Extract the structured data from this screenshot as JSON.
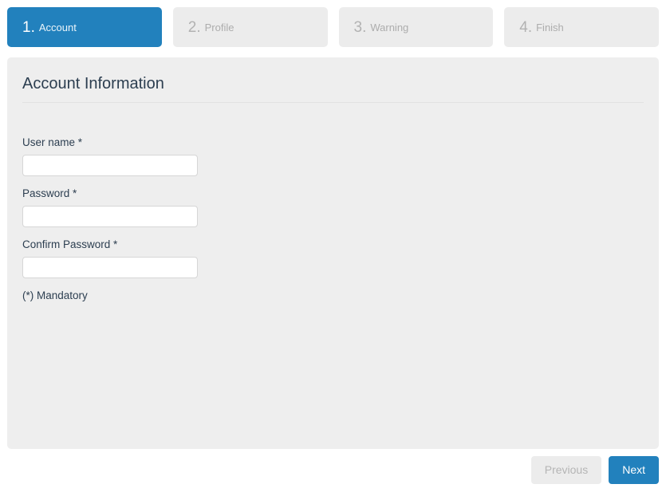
{
  "theme": {
    "accent": "#2281bd",
    "panel_bg": "#eeeeee",
    "inactive_tab_bg": "#ececec",
    "inactive_tab_text": "#adadad",
    "label_text": "#2c3e50",
    "page_bg": "#ffffff"
  },
  "steps": [
    {
      "number": "1.",
      "label": "Account",
      "state": "active"
    },
    {
      "number": "2.",
      "label": "Profile",
      "state": "inactive"
    },
    {
      "number": "3.",
      "label": "Warning",
      "state": "inactive"
    },
    {
      "number": "4.",
      "label": "Finish",
      "state": "inactive"
    }
  ],
  "panel": {
    "title": "Account Information",
    "fields": [
      {
        "label": "User name *",
        "value": "",
        "placeholder": ""
      },
      {
        "label": "Password *",
        "value": "",
        "placeholder": ""
      },
      {
        "label": "Confirm Password *",
        "value": "",
        "placeholder": ""
      }
    ],
    "mandatory_note": "(*) Mandatory"
  },
  "footer": {
    "previous_label": "Previous",
    "next_label": "Next"
  }
}
